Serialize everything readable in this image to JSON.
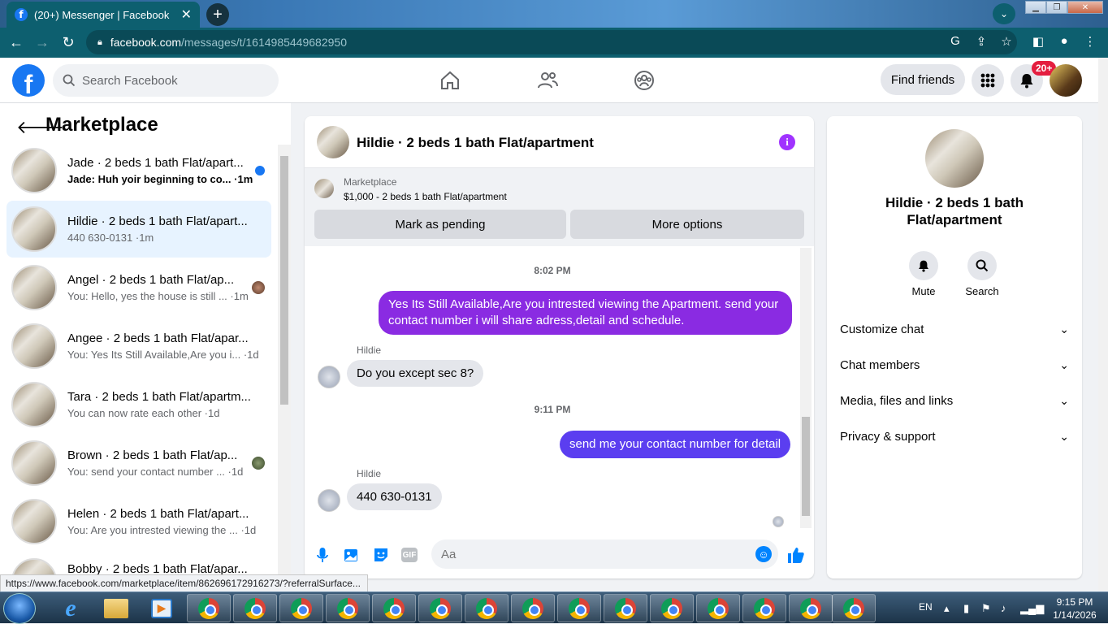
{
  "browser": {
    "tab_title": "(20+) Messenger | Facebook",
    "url_host": "facebook.com",
    "url_path": "/messages/t/1614985449682950",
    "status_url": "https://www.facebook.com/marketplace/item/862696172916273/?referralSurface..."
  },
  "fb": {
    "logo": "f",
    "search_placeholder": "Search Facebook",
    "find_friends": "Find friends",
    "notif_badge": "20+"
  },
  "sidebar": {
    "title": "Marketplace",
    "conversations": [
      {
        "name": "Jade · 2 beds 1 bath Flat/apart...",
        "preview": "Jade: Huh yoir beginning to co...",
        "time": "1m",
        "indicator": "unread-dot"
      },
      {
        "name": "Hildie · 2 beds 1 bath Flat/apart...",
        "preview": "440 630-0131",
        "time": "1m",
        "indicator": "none"
      },
      {
        "name": "Angel · 2 beds 1 bath Flat/ap...",
        "preview": "You: Hello, yes the house is still ...",
        "time": "1m",
        "indicator": "seen-avatar"
      },
      {
        "name": "Angee · 2 beds 1 bath Flat/apar...",
        "preview": "You: Yes Its Still Available,Are you i...",
        "time": "1d",
        "indicator": "none"
      },
      {
        "name": "Tara · 2 beds 1 bath Flat/apartm...",
        "preview": "You can now rate each other",
        "time": "1d",
        "indicator": "none"
      },
      {
        "name": "Brown · 2 beds 1 bath Flat/ap...",
        "preview": "You: send your contact number ...",
        "time": "1d",
        "indicator": "seen-avatar"
      },
      {
        "name": "Helen · 2 beds 1 bath Flat/apart...",
        "preview": "You: Are you intrested viewing the ...",
        "time": "1d",
        "indicator": "none"
      },
      {
        "name": "Bobby · 2 beds 1 bath Flat/apar...",
        "preview": "",
        "time": "",
        "indicator": "none"
      }
    ]
  },
  "chat": {
    "title": "Hildie · 2 beds 1 bath Flat/apartment",
    "marketplace_label": "Marketplace",
    "listing": "$1,000 - 2 beds 1 bath Flat/apartment",
    "mark_pending": "Mark as pending",
    "more_options": "More options",
    "messages": {
      "ts1": "8:02 PM",
      "out1": "Yes Its Still Available,Are you intrested viewing the Apartment. send your contact number i will share adress,detail and schedule.",
      "sender1": "Hildie",
      "in1": "Do you except sec 8?",
      "ts2": "9:11 PM",
      "out2": "send me your contact number for detail",
      "sender2": "Hildie",
      "in2": "440 630-0131"
    },
    "input_placeholder": "Aa",
    "gif_label": "GIF"
  },
  "right_panel": {
    "title": "Hildie · 2 beds 1 bath Flat/apartment",
    "mute": "Mute",
    "search": "Search",
    "sections": [
      "Customize chat",
      "Chat members",
      "Media, files and links",
      "Privacy & support"
    ]
  },
  "taskbar": {
    "lang": "EN",
    "time": "9:15 PM",
    "date": "1/14/2026"
  },
  "colors": {
    "brand": "#1877f2",
    "outgoing_bubble": "#8a2be2",
    "outgoing_bubble_2": "#5b3ef0",
    "chrome_bar": "#0d5f6f"
  }
}
